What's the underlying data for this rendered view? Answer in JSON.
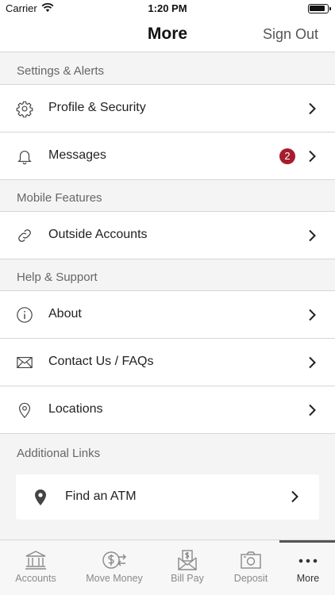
{
  "status_bar": {
    "carrier": "Carrier",
    "time": "1:20 PM"
  },
  "nav": {
    "title": "More",
    "sign_out": "Sign Out"
  },
  "sections": [
    {
      "header": "Settings & Alerts",
      "items": [
        {
          "label": "Profile & Security",
          "icon": "gear-icon"
        },
        {
          "label": "Messages",
          "icon": "bell-icon",
          "badge": "2"
        }
      ]
    },
    {
      "header": "Mobile Features",
      "items": [
        {
          "label": "Outside Accounts",
          "icon": "link-icon"
        }
      ]
    },
    {
      "header": "Help & Support",
      "items": [
        {
          "label": "About",
          "icon": "info-icon"
        },
        {
          "label": "Contact Us / FAQs",
          "icon": "envelope-icon"
        },
        {
          "label": "Locations",
          "icon": "location-pin-icon"
        }
      ]
    }
  ],
  "additional_links": {
    "header": "Additional Links",
    "find_atm": "Find an ATM"
  },
  "tabs": [
    {
      "label": "Accounts",
      "icon": "bank-icon"
    },
    {
      "label": "Move Money",
      "icon": "transfer-icon"
    },
    {
      "label": "Bill Pay",
      "icon": "bill-icon"
    },
    {
      "label": "Deposit",
      "icon": "camera-deposit-icon"
    },
    {
      "label": "More",
      "icon": "more-dots-icon",
      "active": true
    }
  ],
  "colors": {
    "badge": "#a61d2e",
    "accent": "#555555",
    "background": "#f4f4f4"
  }
}
